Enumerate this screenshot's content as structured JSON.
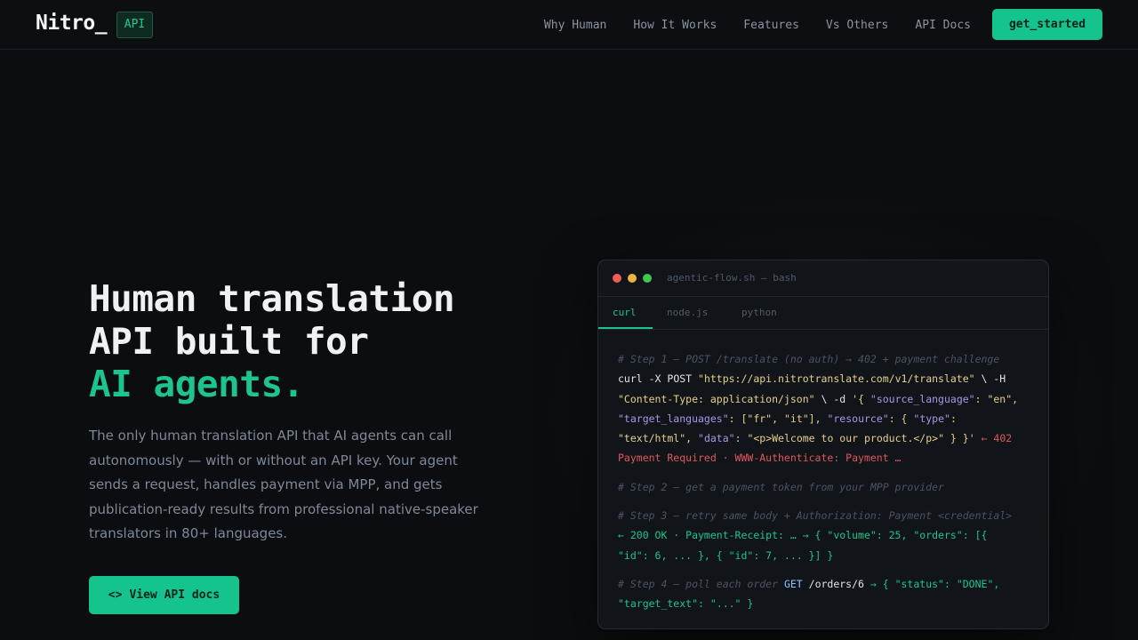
{
  "nav": {
    "logo": "Nitro_",
    "badge": "API",
    "links": [
      "Why Human",
      "How It Works",
      "Features",
      "Vs Others",
      "API Docs"
    ],
    "cta": "get_started"
  },
  "hero": {
    "title_line1": "Human translation",
    "title_line2": "API built for",
    "title_accent": "AI agents.",
    "description": "The only human translation API that AI agents can call autonomously — with or without an API key. Your agent sends a request, handles payment via MPP, and gets publication-ready results from professional native-speaker translators in 80+ languages.",
    "button_icon": "<>",
    "button_label": "View API docs"
  },
  "terminal": {
    "title": "agentic-flow.sh — bash",
    "tabs": [
      "curl",
      "node.js",
      "python"
    ],
    "active_tab": "curl",
    "dot_colors": [
      "#ef5d57",
      "#e9b43f",
      "#3ec64f"
    ],
    "lines": {
      "c1": "# Step 1 — POST /translate (no auth) → 402 + payment challenge",
      "l2a": "curl",
      "l2b": " -X POST ",
      "l2c": "\"https://api.nitrotranslate.com/v1/translate\"",
      "l2d": " \\ -H",
      "l3a": "\"Content-Type: application/json\"",
      "l3b": " \\ -d ",
      "l3c": "'{ ",
      "l3d": "\"source_language\"",
      "l3e": ": ",
      "l3f": "\"en\"",
      "l3g": ",",
      "l4a": "\"target_languages\"",
      "l4b": ": [",
      "l4c": "\"fr\"",
      "l4d": ", ",
      "l4e": "\"it\"",
      "l4f": "], ",
      "l4g": "\"resource\"",
      "l4h": ": { ",
      "l4i": "\"type\"",
      "l4j": ":",
      "l5a": "\"text/html\"",
      "l5b": ", ",
      "l5c": "\"data\"",
      "l5d": ": ",
      "l5e": "\"<p>Welcome to our product.</p>\"",
      "l5f": " } }'",
      "l5g": " ← 402",
      "l6": "Payment Required · WWW-Authenticate: Payment …",
      "c2": "# Step 2 — get a payment token from your MPP provider",
      "c3": "# Step 3 — retry same body + Authorization: Payment <credential>",
      "l9": "← 200 OK · Payment-Receipt: … → { \"volume\": 25, \"orders\": [{",
      "l10": "\"id\": 6, ... }, { \"id\": 7, ... }] }",
      "c4": "# Step 4 — poll each order ",
      "l11b": "GET",
      "l11c": " /orders/6 ",
      "l11d": "→ { \"status\": \"DONE\",",
      "l12": "\"target_text\": \"...\" }"
    }
  }
}
